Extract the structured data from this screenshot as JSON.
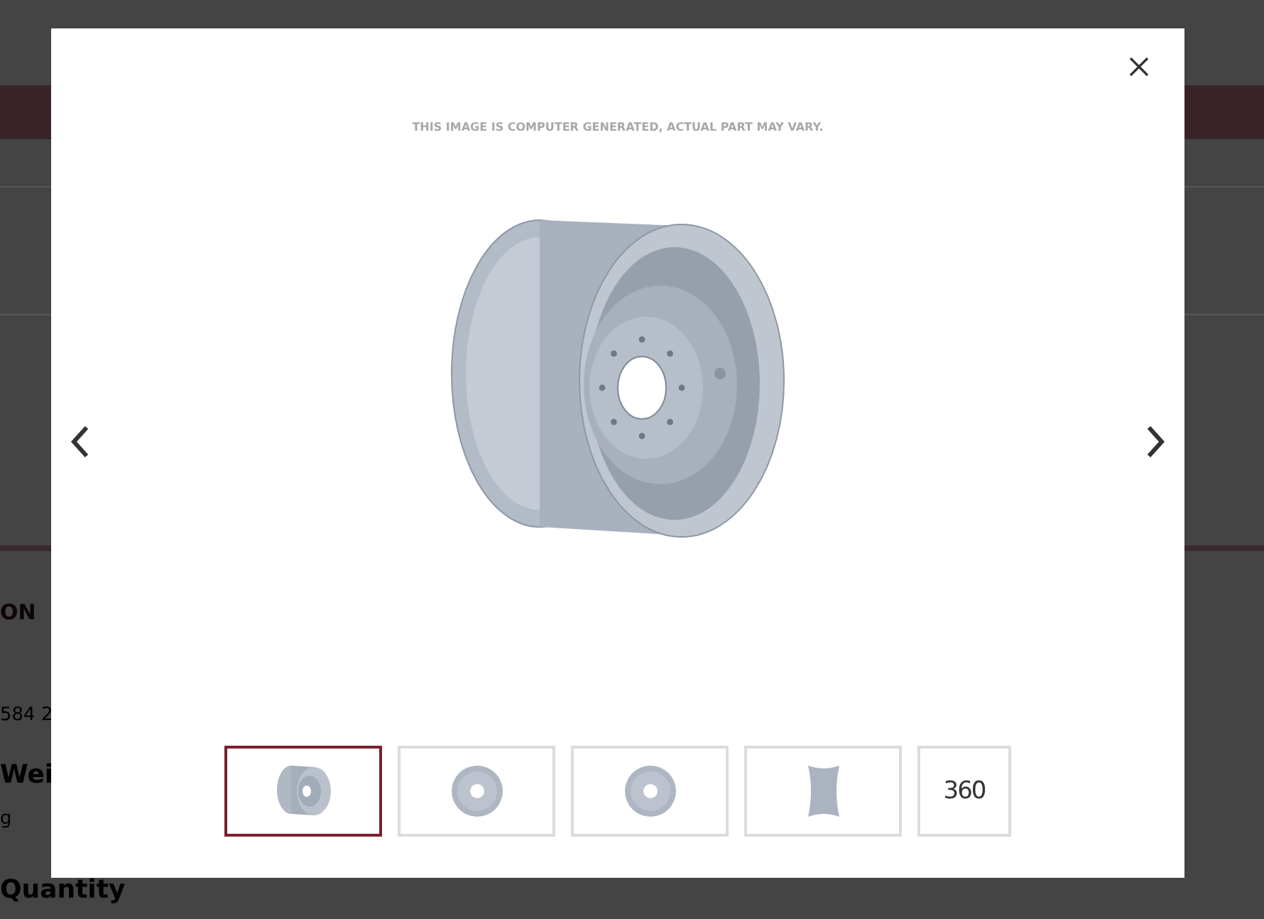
{
  "background_page": {
    "heading": "ON",
    "part_number": "584 2",
    "weight_label": "Wei",
    "weight_value": "g",
    "quantity_label": "Quantity"
  },
  "modal": {
    "caption": "THIS IMAGE IS COMPUTER GENERATED, ACTUAL PART MAY VARY.",
    "thumbnails": [
      {
        "kind": "angled",
        "selected": true
      },
      {
        "kind": "front",
        "selected": false
      },
      {
        "kind": "front",
        "selected": false
      },
      {
        "kind": "side",
        "selected": false
      },
      {
        "kind": "label",
        "label": "360",
        "selected": false
      }
    ]
  }
}
